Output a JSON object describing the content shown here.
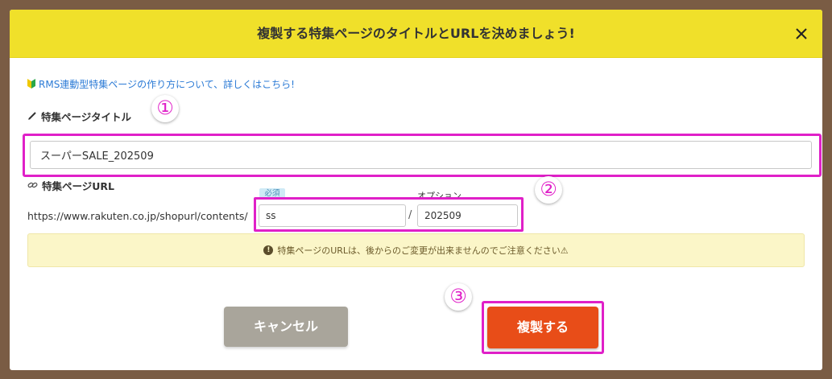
{
  "dialog": {
    "title": "複製する特集ページのタイトルとURLを決めましょう!",
    "help_link": "RMS連動型特集ページの作り方について、詳しくはこちら!"
  },
  "title_field": {
    "label": "特集ページタイトル",
    "value": "スーパーSALE_202509"
  },
  "url_field": {
    "label": "特集ページURL",
    "prefix": "https://www.rakuten.co.jp/shopurl/contents/",
    "required_badge": "必須",
    "option_label": "オプション",
    "path_value": "ss",
    "separator": "/",
    "option_value": "202509"
  },
  "notice": {
    "text": "特集ページのURLは、後からのご変更が出来ませんのでご注意ください⚠"
  },
  "buttons": {
    "cancel": "キャンセル",
    "duplicate": "複製する"
  },
  "annotations": {
    "step1": "①",
    "step2": "②",
    "step3": "③"
  },
  "colors": {
    "header_bg": "#f0e02a",
    "highlight": "#e020c8",
    "primary_button": "#e84d18",
    "cancel_button": "#a9a59b",
    "link": "#2c7bd6",
    "notice_bg": "#fbf6c8",
    "frame": "#7a5c44"
  },
  "icons": {
    "close": "close-icon",
    "help": "beginner-mark-icon",
    "title_label": "pencil-icon",
    "url_label": "link-icon",
    "notice": "info-icon"
  }
}
